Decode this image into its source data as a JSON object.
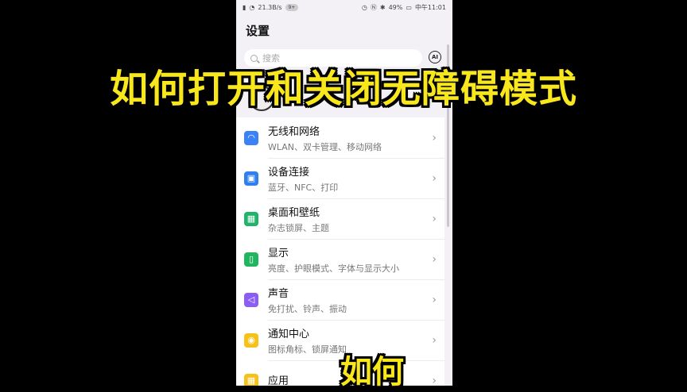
{
  "status_bar": {
    "speed": "21.3B/s",
    "badge": "9+",
    "battery": "49%",
    "time": "中午11:01"
  },
  "header": {
    "title": "设置"
  },
  "search": {
    "placeholder": "搜索"
  },
  "settings_items": [
    {
      "title": "无线和网络",
      "subtitle": "WLAN、双卡管理、移动网络",
      "icon": "wifi-icon",
      "color": "#3b82f6"
    },
    {
      "title": "设备连接",
      "subtitle": "蓝牙、NFC、打印",
      "icon": "device-connection-icon",
      "color": "#2f7ff0"
    },
    {
      "title": "桌面和壁纸",
      "subtitle": "杂志锁屏、主题",
      "icon": "wallpaper-icon",
      "color": "#1fb36b"
    },
    {
      "title": "显示",
      "subtitle": "亮度、护眼模式、字体与显示大小",
      "icon": "display-icon",
      "color": "#22b55f"
    },
    {
      "title": "声音",
      "subtitle": "免打扰、铃声、振动",
      "icon": "sound-icon",
      "color": "#8b5cf6"
    },
    {
      "title": "通知中心",
      "subtitle": "图标角标、锁屏通知",
      "icon": "notification-icon",
      "color": "#f6c21a"
    },
    {
      "title": "应用",
      "subtitle": "",
      "icon": "apps-icon",
      "color": "#f6c21a"
    }
  ],
  "overlay": {
    "title": "如何打开和关闭无障碍模式",
    "subtitle": "如何"
  }
}
